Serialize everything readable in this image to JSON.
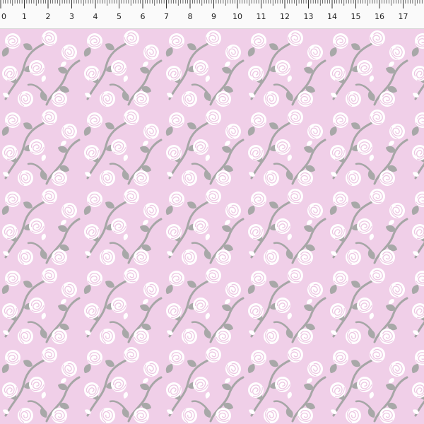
{
  "ruler": {
    "unit": "cm",
    "numbers": [
      "0",
      "1",
      "2",
      "3",
      "4",
      "5",
      "6",
      "7",
      "8",
      "9",
      "10",
      "11",
      "12",
      "13",
      "14",
      "15",
      "16",
      "17"
    ]
  },
  "fabric": {
    "motif": "white roses with grey leaves and stems",
    "colors": {
      "background": "#f0cfe8",
      "rose": "#ffffff",
      "rose_outline": "#ecc6e2",
      "leaf": "#a8a8a8",
      "stem": "#a6a6a6"
    }
  }
}
